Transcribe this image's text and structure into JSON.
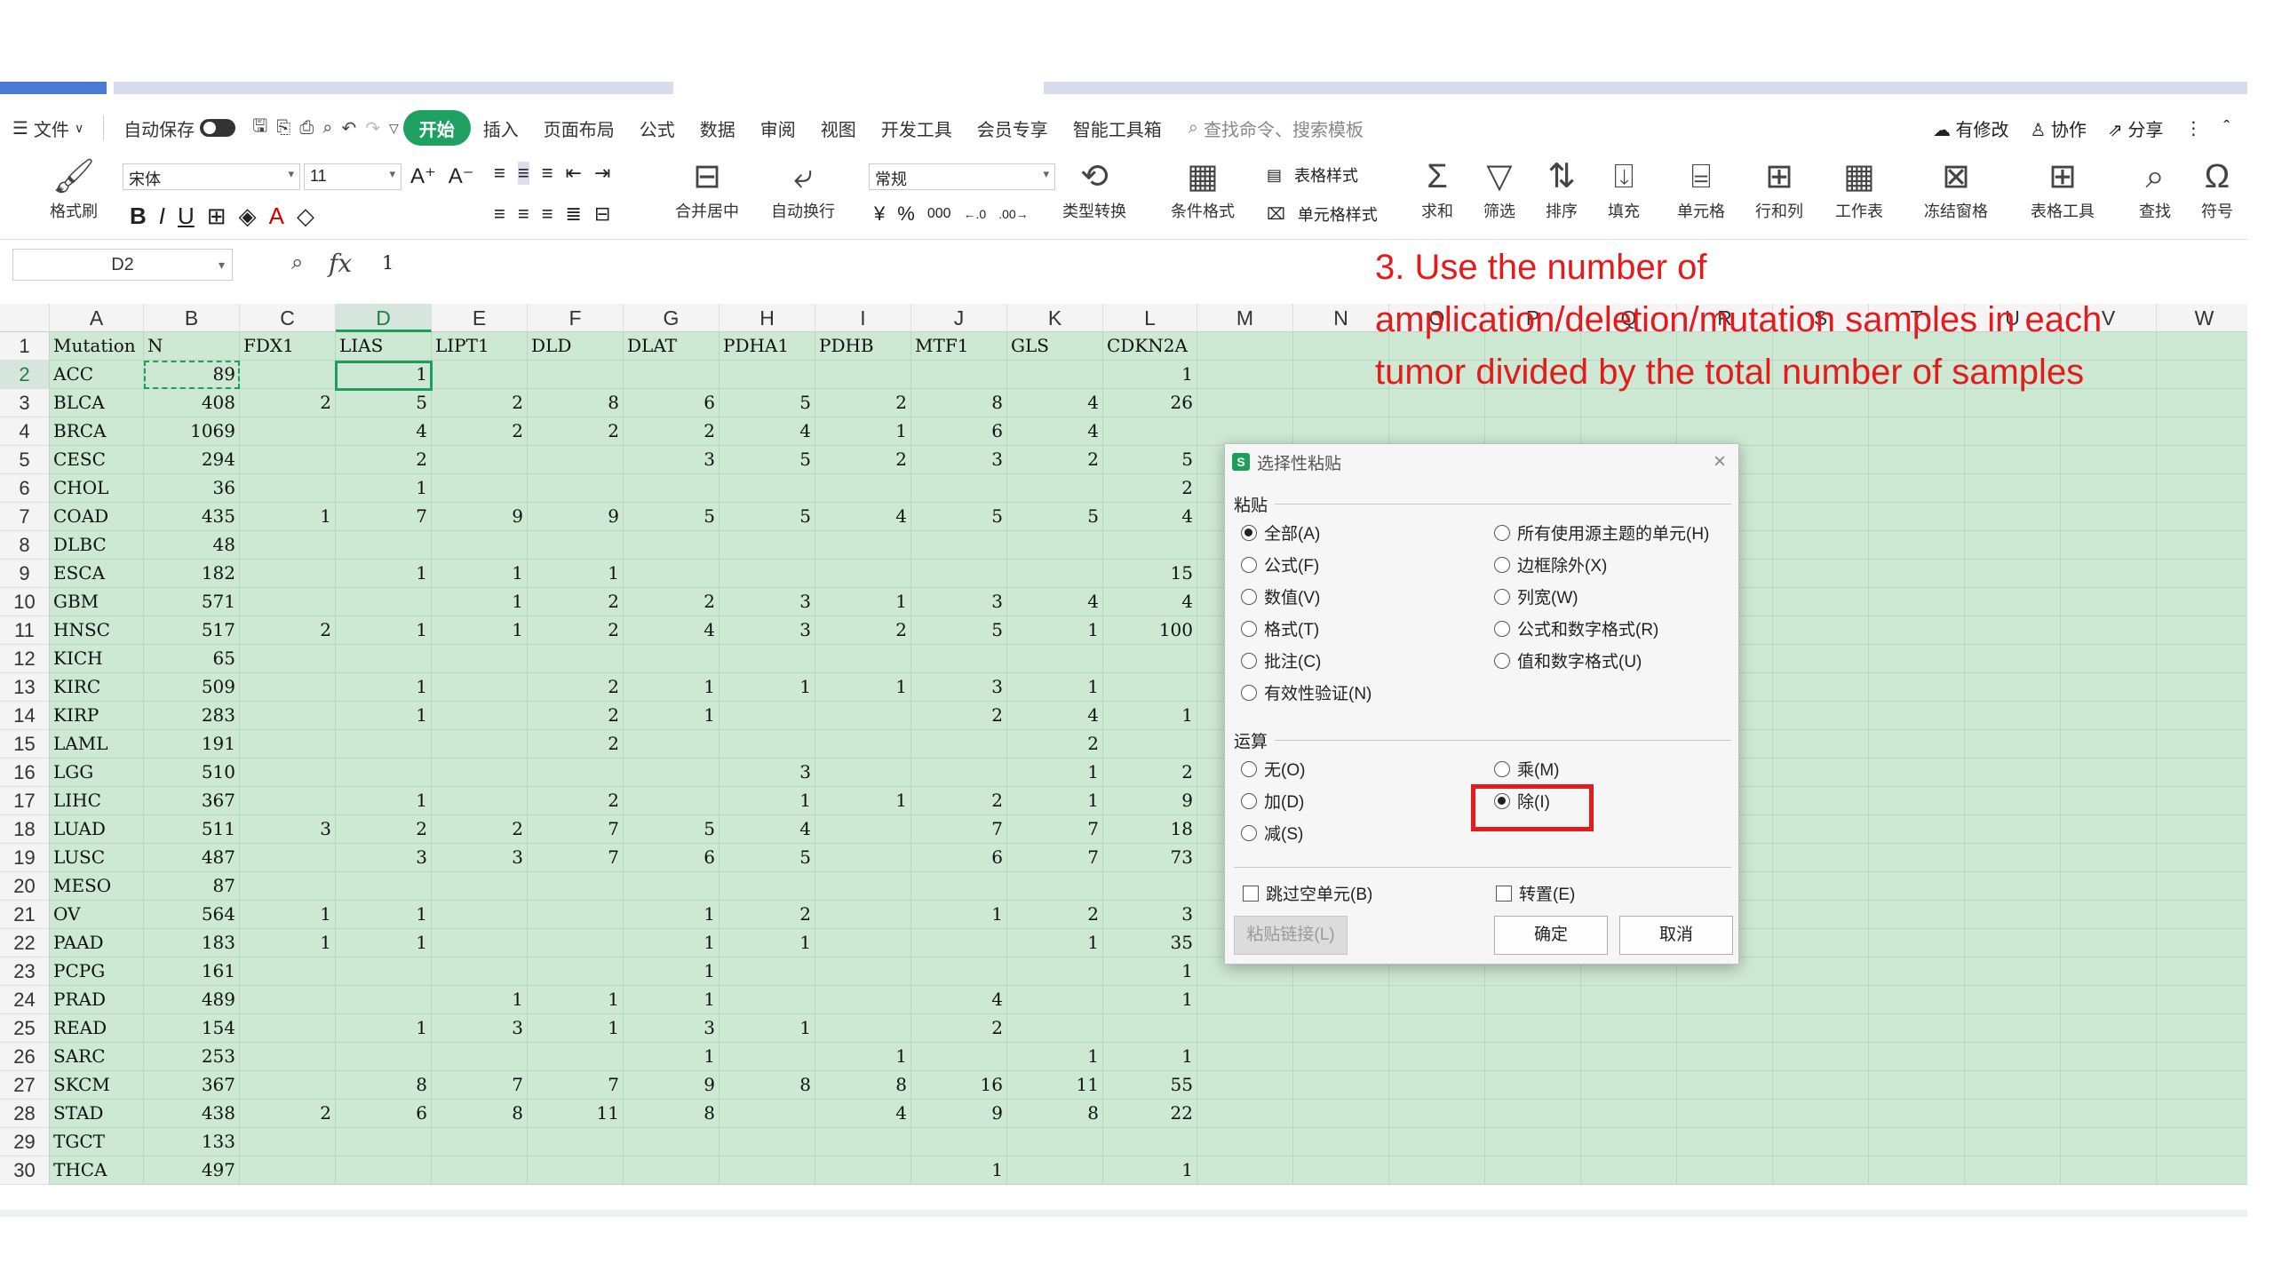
{
  "menubar": {
    "items": [
      "文件",
      "自动保存",
      "开始",
      "插入",
      "页面布局",
      "公式",
      "数据",
      "审阅",
      "视图",
      "开发工具",
      "会员专享",
      "智能工具箱"
    ],
    "search": "查找命令、搜索模板",
    "right": [
      "有修改",
      "协作",
      "分享"
    ]
  },
  "ribbon": {
    "format_painter": "格式刷",
    "font_name": "宋体",
    "font_size": "11",
    "merge": "合并居中",
    "wrap": "自动换行",
    "number_format": "常规",
    "convert": "类型转换",
    "cond_format": "条件格式",
    "table_style": "表格样式",
    "cell_style": "单元格样式",
    "sum": "求和",
    "filter": "筛选",
    "sort": "排序",
    "fill": "填充",
    "cells": "单元格",
    "rowcol": "行和列",
    "sheet": "工作表",
    "freeze": "冻结窗格",
    "tools": "表格工具",
    "find": "查找",
    "symbol": "符号"
  },
  "formula_bar": {
    "name_box": "D2",
    "fx": "fx",
    "value": "1"
  },
  "grid": {
    "columns": [
      "A",
      "B",
      "C",
      "D",
      "E",
      "F",
      "G",
      "H",
      "I",
      "J",
      "K",
      "L",
      "M",
      "N",
      "O",
      "P",
      "Q",
      "R",
      "S",
      "T",
      "U",
      "V",
      "W"
    ],
    "rows": [
      {
        "n": "1",
        "cells": [
          "Mutation",
          "N",
          "FDX1",
          "LIAS",
          "LIPT1",
          "DLD",
          "DLAT",
          "PDHA1",
          "PDHB",
          "MTF1",
          "GLS",
          "CDKN2A"
        ]
      },
      {
        "n": "2",
        "cells": [
          "ACC",
          "89",
          "",
          "1",
          "",
          "",
          "",
          "",
          "",
          "",
          "",
          "1"
        ]
      },
      {
        "n": "3",
        "cells": [
          "BLCA",
          "408",
          "2",
          "5",
          "2",
          "8",
          "6",
          "5",
          "2",
          "8",
          "4",
          "26"
        ]
      },
      {
        "n": "4",
        "cells": [
          "BRCA",
          "1069",
          "",
          "4",
          "2",
          "2",
          "2",
          "4",
          "1",
          "6",
          "4",
          ""
        ]
      },
      {
        "n": "5",
        "cells": [
          "CESC",
          "294",
          "",
          "2",
          "",
          "",
          "3",
          "5",
          "2",
          "3",
          "2",
          "5"
        ]
      },
      {
        "n": "6",
        "cells": [
          "CHOL",
          "36",
          "",
          "1",
          "",
          "",
          "",
          "",
          "",
          "",
          "",
          "2"
        ]
      },
      {
        "n": "7",
        "cells": [
          "COAD",
          "435",
          "1",
          "7",
          "9",
          "9",
          "5",
          "5",
          "4",
          "5",
          "5",
          "4"
        ]
      },
      {
        "n": "8",
        "cells": [
          "DLBC",
          "48",
          "",
          "",
          "",
          "",
          "",
          "",
          "",
          "",
          "",
          ""
        ]
      },
      {
        "n": "9",
        "cells": [
          "ESCA",
          "182",
          "",
          "1",
          "1",
          "1",
          "",
          "",
          "",
          "",
          "",
          "15"
        ]
      },
      {
        "n": "10",
        "cells": [
          "GBM",
          "571",
          "",
          "",
          "1",
          "2",
          "2",
          "3",
          "1",
          "3",
          "4",
          "4"
        ]
      },
      {
        "n": "11",
        "cells": [
          "HNSC",
          "517",
          "2",
          "1",
          "1",
          "2",
          "4",
          "3",
          "2",
          "5",
          "1",
          "100"
        ]
      },
      {
        "n": "12",
        "cells": [
          "KICH",
          "65",
          "",
          "",
          "",
          "",
          "",
          "",
          "",
          "",
          "",
          ""
        ]
      },
      {
        "n": "13",
        "cells": [
          "KIRC",
          "509",
          "",
          "1",
          "",
          "2",
          "1",
          "1",
          "1",
          "3",
          "1",
          ""
        ]
      },
      {
        "n": "14",
        "cells": [
          "KIRP",
          "283",
          "",
          "1",
          "",
          "2",
          "1",
          "",
          "",
          "2",
          "4",
          "1"
        ]
      },
      {
        "n": "15",
        "cells": [
          "LAML",
          "191",
          "",
          "",
          "",
          "2",
          "",
          "",
          "",
          "",
          "2",
          ""
        ]
      },
      {
        "n": "16",
        "cells": [
          "LGG",
          "510",
          "",
          "",
          "",
          "",
          "",
          "3",
          "",
          "",
          "1",
          "2"
        ]
      },
      {
        "n": "17",
        "cells": [
          "LIHC",
          "367",
          "",
          "1",
          "",
          "2",
          "",
          "1",
          "1",
          "2",
          "1",
          "9"
        ]
      },
      {
        "n": "18",
        "cells": [
          "LUAD",
          "511",
          "3",
          "2",
          "2",
          "7",
          "5",
          "4",
          "",
          "7",
          "7",
          "18"
        ]
      },
      {
        "n": "19",
        "cells": [
          "LUSC",
          "487",
          "",
          "3",
          "3",
          "7",
          "6",
          "5",
          "",
          "6",
          "7",
          "73"
        ]
      },
      {
        "n": "20",
        "cells": [
          "MESO",
          "87",
          "",
          "",
          "",
          "",
          "",
          "",
          "",
          "",
          "",
          ""
        ]
      },
      {
        "n": "21",
        "cells": [
          "OV",
          "564",
          "1",
          "1",
          "",
          "",
          "1",
          "2",
          "",
          "1",
          "2",
          "3"
        ]
      },
      {
        "n": "22",
        "cells": [
          "PAAD",
          "183",
          "1",
          "1",
          "",
          "",
          "1",
          "1",
          "",
          "",
          "1",
          "35"
        ]
      },
      {
        "n": "23",
        "cells": [
          "PCPG",
          "161",
          "",
          "",
          "",
          "",
          "1",
          "",
          "",
          "",
          "",
          "1"
        ]
      },
      {
        "n": "24",
        "cells": [
          "PRAD",
          "489",
          "",
          "",
          "1",
          "1",
          "1",
          "",
          "",
          "4",
          "",
          "1"
        ]
      },
      {
        "n": "25",
        "cells": [
          "READ",
          "154",
          "",
          "1",
          "3",
          "1",
          "3",
          "1",
          "",
          "2",
          "",
          ""
        ]
      },
      {
        "n": "26",
        "cells": [
          "SARC",
          "253",
          "",
          "",
          "",
          "",
          "1",
          "",
          "1",
          "",
          "1",
          "1"
        ]
      },
      {
        "n": "27",
        "cells": [
          "SKCM",
          "367",
          "",
          "8",
          "7",
          "7",
          "9",
          "8",
          "8",
          "16",
          "11",
          "55"
        ]
      },
      {
        "n": "28",
        "cells": [
          "STAD",
          "438",
          "2",
          "6",
          "8",
          "11",
          "8",
          "",
          "4",
          "9",
          "8",
          "22"
        ]
      },
      {
        "n": "29",
        "cells": [
          "TGCT",
          "133",
          "",
          "",
          "",
          "",
          "",
          "",
          "",
          "",
          "",
          ""
        ]
      },
      {
        "n": "30",
        "cells": [
          "THCA",
          "497",
          "",
          "",
          "",
          "",
          "",
          "",
          "",
          "1",
          "",
          "1"
        ]
      }
    ]
  },
  "annotation": "3. Use the number of amplication/deletion/mutation samples in each tumor divided by the total number of samples",
  "dialog": {
    "title": "选择性粘贴",
    "paste_label": "粘贴",
    "paste_left": [
      {
        "label": "全部(A)",
        "checked": true
      },
      {
        "label": "公式(F)",
        "checked": false
      },
      {
        "label": "数值(V)",
        "checked": false
      },
      {
        "label": "格式(T)",
        "checked": false
      },
      {
        "label": "批注(C)",
        "checked": false
      },
      {
        "label": "有效性验证(N)",
        "checked": false
      }
    ],
    "paste_right": [
      {
        "label": "所有使用源主题的单元(H)",
        "checked": false
      },
      {
        "label": "边框除外(X)",
        "checked": false
      },
      {
        "label": "列宽(W)",
        "checked": false
      },
      {
        "label": "公式和数字格式(R)",
        "checked": false
      },
      {
        "label": "值和数字格式(U)",
        "checked": false
      }
    ],
    "op_label": "运算",
    "op_left": [
      {
        "label": "无(O)",
        "checked": false
      },
      {
        "label": "加(D)",
        "checked": false
      },
      {
        "label": "减(S)",
        "checked": false
      }
    ],
    "op_right": [
      {
        "label": "乘(M)",
        "checked": false
      },
      {
        "label": "除(I)",
        "checked": true
      }
    ],
    "skip_blanks": "跳过空单元(B)",
    "transpose": "转置(E)",
    "paste_link": "粘贴链接(L)",
    "ok": "确定",
    "cancel": "取消"
  }
}
